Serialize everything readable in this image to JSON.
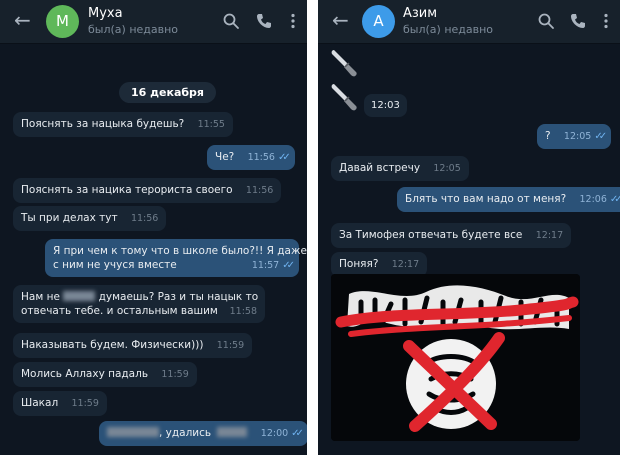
{
  "left_chat": {
    "contact_name": "Муха",
    "avatar_letter": "М",
    "avatar_color": "#5fb85a",
    "status": "был(а) недавно",
    "date_label": "16 декабря",
    "messages": [
      {
        "text": "Пояснять за нацыка будешь?",
        "time": "11:55",
        "outgoing": false
      },
      {
        "text": "Че?",
        "time": "11:56",
        "outgoing": true
      },
      {
        "text": "Пояснять за нацика терориста своего",
        "time": "11:56",
        "outgoing": false
      },
      {
        "text": "Ты при делах тут",
        "time": "11:56",
        "outgoing": false
      },
      {
        "line1": "Я при чем к тому что в школе было?!! Я даже",
        "line2": "с ним не учуся вместе",
        "time": "11:57",
        "outgoing": true
      },
      {
        "prefix": "Нам не",
        "suffix": "думаешь? Раз и ты нацык то",
        "line2": "отвечать тебе. и остальным вашим",
        "time": "11:58",
        "outgoing": false
      },
      {
        "text": "Наказывать будем. Физически)))",
        "time": "11:59",
        "outgoing": false
      },
      {
        "text": "Молись Аллаху падаль",
        "time": "11:59",
        "outgoing": false
      },
      {
        "text": "Шакал",
        "time": "11:59",
        "outgoing": false
      },
      {
        "suffix": ", удались",
        "time": "12:00",
        "outgoing": true
      }
    ]
  },
  "right_chat": {
    "contact_name": "Азим",
    "avatar_letter": "А",
    "avatar_color": "#3d9be9",
    "status": "был(а) недавно",
    "messages": [
      {
        "time": "12:03",
        "kind": "knife-sticker"
      },
      {
        "text": "?",
        "time": "12:05",
        "outgoing": true
      },
      {
        "text": "Давай встречу",
        "time": "12:05",
        "outgoing": false
      },
      {
        "text": "Блять что вам надо от меня?",
        "time": "12:06",
        "outgoing": true
      },
      {
        "text": "За Тимофея отвечать будете все",
        "time": "12:17",
        "outgoing": false
      },
      {
        "text": "Поняя?",
        "time": "12:17",
        "outgoing": false
      }
    ]
  },
  "colors": {
    "chat_background": "#0e1621",
    "header_background": "#17212b",
    "incoming_bubble": "#182533",
    "outgoing_bubble": "#2b5278",
    "read_tick": "#6fb2ef",
    "strike_red": "#e0262e"
  },
  "icons": [
    "back-arrow-icon",
    "search-icon",
    "phone-icon",
    "more-vert-icon",
    "double-check-icon",
    "knife-icon"
  ]
}
